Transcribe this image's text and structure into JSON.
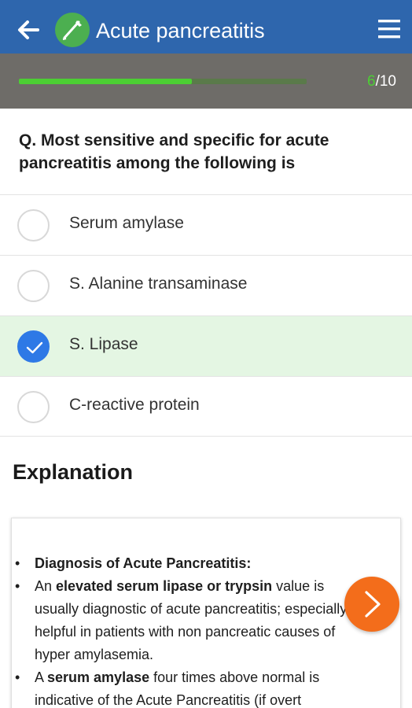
{
  "appbar": {
    "title": "Acute pancreatitis",
    "back_icon": "arrow-left-icon",
    "logo_icon": "scalpel-logo-icon",
    "menu_icon": "hamburger-menu-icon",
    "color": "#2e66ad"
  },
  "progress": {
    "current": "6",
    "total": "/10",
    "fraction": 0.6,
    "fill_color": "#4ccf34"
  },
  "question": {
    "text": "Q. Most sensitive and specific for acute pancreatitis among the following is"
  },
  "options": [
    {
      "label": "Serum amylase",
      "selected": false
    },
    {
      "label": "S. Alanine transaminase",
      "selected": false
    },
    {
      "label": "S. Lipase",
      "selected": true
    },
    {
      "label": "C-reactive protein",
      "selected": false
    }
  ],
  "explanation": {
    "heading": "Explanation",
    "items": [
      {
        "parts": [
          {
            "text": "Diagnosis of Acute Pancreatitis:",
            "bold": true
          }
        ]
      },
      {
        "parts": [
          {
            "text": "An ",
            "bold": false
          },
          {
            "text": "elevated serum lipase or trypsin",
            "bold": true
          },
          {
            "text": " value is usually diagnostic of acute pancreatitis; especially helpful in patients with non pancreatic causes of hyper amylasemia.",
            "bold": false
          }
        ]
      },
      {
        "parts": [
          {
            "text": "A ",
            "bold": false
          },
          {
            "text": "serum amylase",
            "bold": true
          },
          {
            "text": " four times above normal is indicative of the Acute Pancreatitis (if overt",
            "bold": false
          }
        ]
      }
    ]
  },
  "next_button": {
    "icon": "chevron-right-icon",
    "color": "#f36d1b"
  }
}
